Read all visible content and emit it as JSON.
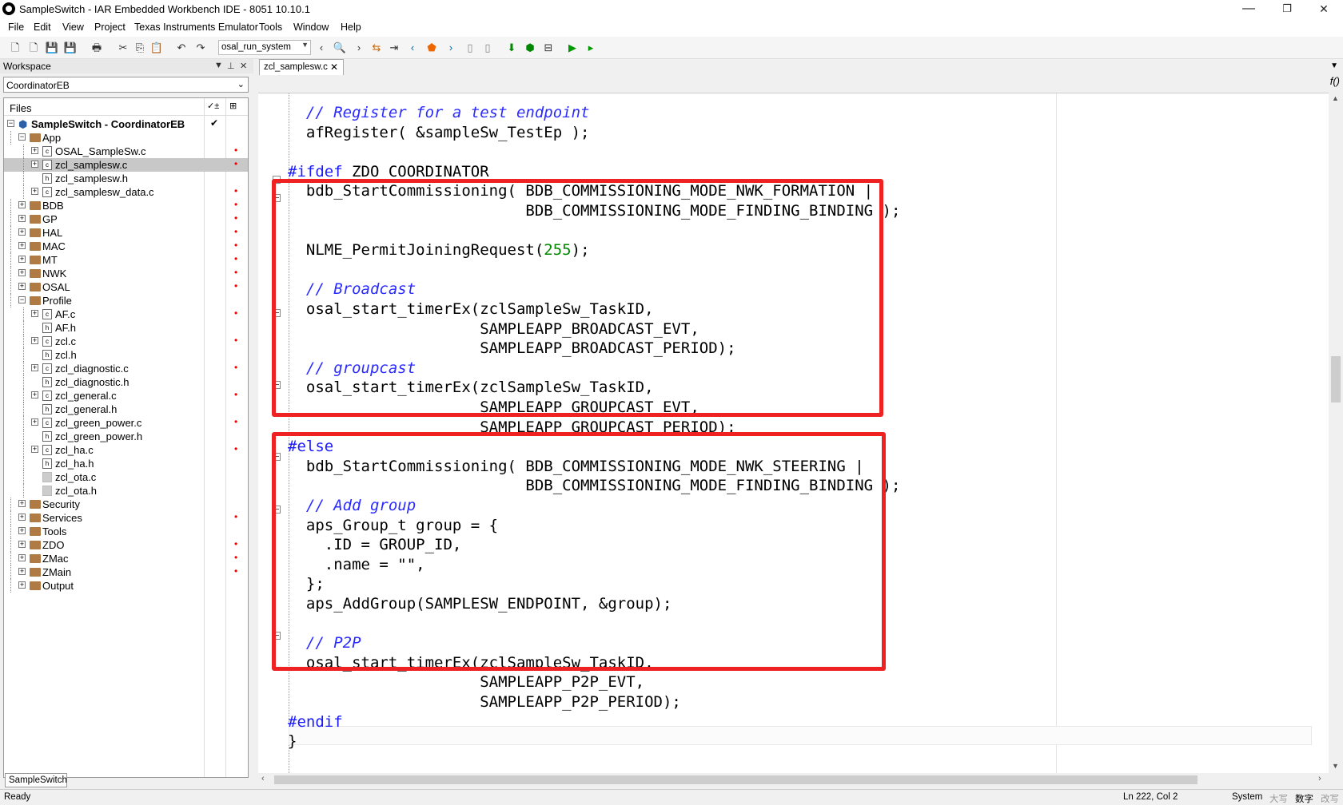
{
  "window": {
    "title": "SampleSwitch - IAR Embedded Workbench IDE - 8051 10.10.1",
    "minimize": "—",
    "restore": "❐",
    "close": "✕"
  },
  "menu": {
    "file": "File",
    "edit": "Edit",
    "view": "View",
    "project": "Project",
    "emulator": "Texas Instruments Emulator",
    "tools": "Tools",
    "window": "Window",
    "help": "Help"
  },
  "toolbar": {
    "search_value": "osal_run_system"
  },
  "workspace": {
    "title": "Workspace",
    "config": "CoordinatorEB",
    "files_header": "Files",
    "project_name": "SampleSwitch - CoordinatorEB",
    "project_check": "✔",
    "tab": "SampleSwitch",
    "tree": [
      {
        "label": "App",
        "type": "dir",
        "depth": 1,
        "exp": "−",
        "mark": ""
      },
      {
        "label": "OSAL_SampleSw.c",
        "type": "c",
        "depth": 2,
        "exp": "+",
        "mark": "•"
      },
      {
        "label": "zcl_samplesw.c",
        "type": "c",
        "depth": 2,
        "exp": "+",
        "mark": "•",
        "selected": true
      },
      {
        "label": "zcl_samplesw.h",
        "type": "h",
        "depth": 2,
        "exp": "",
        "mark": ""
      },
      {
        "label": "zcl_samplesw_data.c",
        "type": "c",
        "depth": 2,
        "exp": "+",
        "mark": "•"
      },
      {
        "label": "BDB",
        "type": "dir",
        "depth": 1,
        "exp": "+",
        "mark": "•"
      },
      {
        "label": "GP",
        "type": "dir",
        "depth": 1,
        "exp": "+",
        "mark": "•"
      },
      {
        "label": "HAL",
        "type": "dir",
        "depth": 1,
        "exp": "+",
        "mark": "•"
      },
      {
        "label": "MAC",
        "type": "dir",
        "depth": 1,
        "exp": "+",
        "mark": "•"
      },
      {
        "label": "MT",
        "type": "dir",
        "depth": 1,
        "exp": "+",
        "mark": "•"
      },
      {
        "label": "NWK",
        "type": "dir",
        "depth": 1,
        "exp": "+",
        "mark": "•"
      },
      {
        "label": "OSAL",
        "type": "dir",
        "depth": 1,
        "exp": "+",
        "mark": "•"
      },
      {
        "label": "Profile",
        "type": "dir",
        "depth": 1,
        "exp": "−",
        "mark": ""
      },
      {
        "label": "AF.c",
        "type": "c",
        "depth": 2,
        "exp": "+",
        "mark": "•"
      },
      {
        "label": "AF.h",
        "type": "h",
        "depth": 2,
        "exp": "",
        "mark": ""
      },
      {
        "label": "zcl.c",
        "type": "c",
        "depth": 2,
        "exp": "+",
        "mark": "•"
      },
      {
        "label": "zcl.h",
        "type": "h",
        "depth": 2,
        "exp": "",
        "mark": ""
      },
      {
        "label": "zcl_diagnostic.c",
        "type": "c",
        "depth": 2,
        "exp": "+",
        "mark": "•"
      },
      {
        "label": "zcl_diagnostic.h",
        "type": "h",
        "depth": 2,
        "exp": "",
        "mark": ""
      },
      {
        "label": "zcl_general.c",
        "type": "c",
        "depth": 2,
        "exp": "+",
        "mark": "•"
      },
      {
        "label": "zcl_general.h",
        "type": "h",
        "depth": 2,
        "exp": "",
        "mark": ""
      },
      {
        "label": "zcl_green_power.c",
        "type": "c",
        "depth": 2,
        "exp": "+",
        "mark": "•"
      },
      {
        "label": "zcl_green_power.h",
        "type": "h",
        "depth": 2,
        "exp": "",
        "mark": ""
      },
      {
        "label": "zcl_ha.c",
        "type": "c",
        "depth": 2,
        "exp": "+",
        "mark": "•"
      },
      {
        "label": "zcl_ha.h",
        "type": "h",
        "depth": 2,
        "exp": "",
        "mark": ""
      },
      {
        "label": "zcl_ota.c",
        "type": "g",
        "depth": 2,
        "exp": "",
        "mark": ""
      },
      {
        "label": "zcl_ota.h",
        "type": "g",
        "depth": 2,
        "exp": "",
        "mark": ""
      },
      {
        "label": "Security",
        "type": "dir",
        "depth": 1,
        "exp": "+",
        "mark": ""
      },
      {
        "label": "Services",
        "type": "dir",
        "depth": 1,
        "exp": "+",
        "mark": "•"
      },
      {
        "label": "Tools",
        "type": "dir",
        "depth": 1,
        "exp": "+",
        "mark": ""
      },
      {
        "label": "ZDO",
        "type": "dir",
        "depth": 1,
        "exp": "+",
        "mark": "•"
      },
      {
        "label": "ZMac",
        "type": "dir",
        "depth": 1,
        "exp": "+",
        "mark": "•"
      },
      {
        "label": "ZMain",
        "type": "dir",
        "depth": 1,
        "exp": "+",
        "mark": "•"
      },
      {
        "label": "Output",
        "type": "dir",
        "depth": 1,
        "exp": "+",
        "mark": ""
      }
    ]
  },
  "editor": {
    "tab": "zcl_samplesw.c",
    "lines": [
      {
        "parts": [
          {
            "t": "  "
          },
          {
            "t": "// Register for a test endpoint",
            "c": "cm"
          }
        ]
      },
      {
        "parts": [
          {
            "t": "  afRegister( &sampleSw_TestEp );"
          }
        ]
      },
      {
        "parts": [
          {
            "t": ""
          }
        ]
      },
      {
        "parts": [
          {
            "t": "#ifdef",
            "c": "pp"
          },
          {
            "t": " ZDO_COORDINATOR"
          }
        ]
      },
      {
        "parts": [
          {
            "t": "  bdb_StartCommissioning( BDB_COMMISSIONING_MODE_NWK_FORMATION |"
          }
        ]
      },
      {
        "parts": [
          {
            "t": "                          BDB_COMMISSIONING_MODE_FINDING_BINDING );"
          }
        ]
      },
      {
        "parts": [
          {
            "t": ""
          }
        ]
      },
      {
        "parts": [
          {
            "t": "  NLME_PermitJoiningRequest("
          },
          {
            "t": "255",
            "c": "num"
          },
          {
            "t": ");"
          }
        ]
      },
      {
        "parts": [
          {
            "t": ""
          }
        ]
      },
      {
        "parts": [
          {
            "t": "  "
          },
          {
            "t": "// Broadcast",
            "c": "cm"
          }
        ]
      },
      {
        "parts": [
          {
            "t": "  osal_start_timerEx(zclSampleSw_TaskID,"
          }
        ]
      },
      {
        "parts": [
          {
            "t": "                     SAMPLEAPP_BROADCAST_EVT,"
          }
        ]
      },
      {
        "parts": [
          {
            "t": "                     SAMPLEAPP_BROADCAST_PERIOD);"
          }
        ]
      },
      {
        "parts": [
          {
            "t": "  "
          },
          {
            "t": "// groupcast",
            "c": "cm"
          }
        ]
      },
      {
        "parts": [
          {
            "t": "  osal_start_timerEx(zclSampleSw_TaskID,"
          }
        ]
      },
      {
        "parts": [
          {
            "t": "                     SAMPLEAPP_GROUPCAST_EVT,"
          }
        ]
      },
      {
        "parts": [
          {
            "t": "                     SAMPLEAPP_GROUPCAST_PERIOD);"
          }
        ]
      },
      {
        "parts": [
          {
            "t": "#else",
            "c": "pp"
          }
        ]
      },
      {
        "parts": [
          {
            "t": "  bdb_StartCommissioning( BDB_COMMISSIONING_MODE_NWK_STEERING |"
          }
        ]
      },
      {
        "parts": [
          {
            "t": "                          BDB_COMMISSIONING_MODE_FINDING_BINDING );"
          }
        ]
      },
      {
        "parts": [
          {
            "t": "  "
          },
          {
            "t": "// Add group",
            "c": "cm"
          }
        ]
      },
      {
        "parts": [
          {
            "t": "  aps_Group_t group = {"
          }
        ]
      },
      {
        "parts": [
          {
            "t": "    .ID = GROUP_ID,"
          }
        ]
      },
      {
        "parts": [
          {
            "t": "    .name = \"\","
          }
        ]
      },
      {
        "parts": [
          {
            "t": "  };"
          }
        ]
      },
      {
        "parts": [
          {
            "t": "  aps_AddGroup(SAMPLESW_ENDPOINT, &group);"
          }
        ]
      },
      {
        "parts": [
          {
            "t": ""
          }
        ]
      },
      {
        "parts": [
          {
            "t": "  "
          },
          {
            "t": "// P2P",
            "c": "cm"
          }
        ]
      },
      {
        "parts": [
          {
            "t": "  osal_start_timerEx(zclSampleSw_TaskID,"
          }
        ]
      },
      {
        "parts": [
          {
            "t": "                     SAMPLEAPP_P2P_EVT,"
          }
        ]
      },
      {
        "parts": [
          {
            "t": "                     SAMPLEAPP_P2P_PERIOD);"
          }
        ]
      },
      {
        "parts": [
          {
            "t": "#endif",
            "c": "pp"
          }
        ]
      },
      {
        "parts": [
          {
            "t": "}"
          }
        ]
      },
      {
        "parts": [
          {
            "t": ""
          }
        ]
      },
      {
        "parts": [
          {
            "t": "/*********************************************************************",
            "c": "pp"
          }
        ]
      }
    ]
  },
  "status": {
    "left": "Ready",
    "position": "Ln 222, Col 2",
    "encoding": "System",
    "caps": "大写",
    "num": "数字",
    "ovr": "改写"
  }
}
